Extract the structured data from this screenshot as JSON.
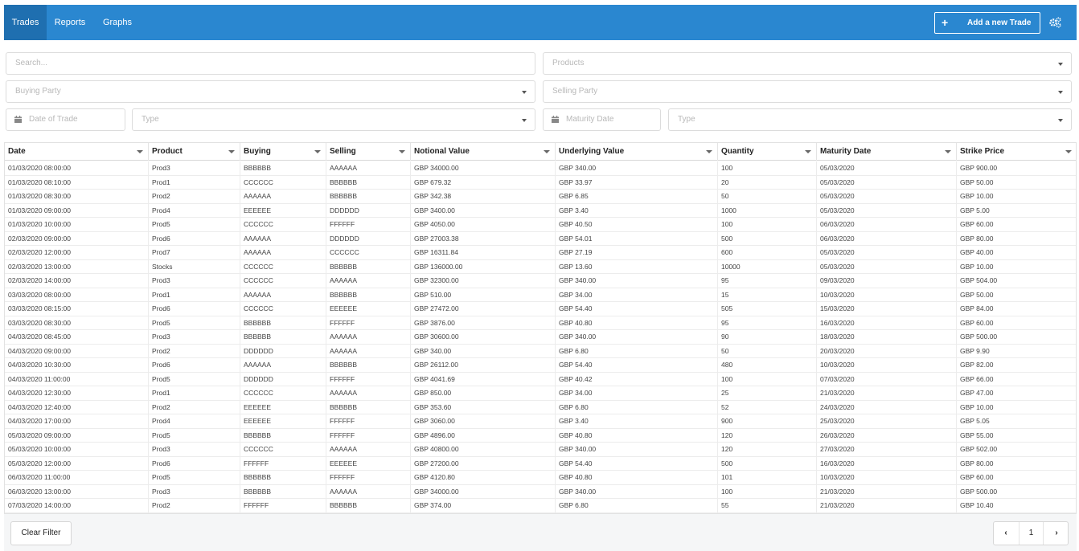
{
  "nav": {
    "tabs": [
      {
        "label": "Trades",
        "active": true
      },
      {
        "label": "Reports",
        "active": false
      },
      {
        "label": "Graphs",
        "active": false
      }
    ],
    "add_button_label": "Add a new Trade",
    "settings_icon": "gears-icon"
  },
  "filters": {
    "search_placeholder": "Search...",
    "products_placeholder": "Products",
    "buying_party_placeholder": "Buying Party",
    "selling_party_placeholder": "Selling Party",
    "date_of_trade_placeholder": "Date of Trade",
    "type_left_placeholder": "Type",
    "maturity_date_placeholder": "Maturity Date",
    "type_right_placeholder": "Type"
  },
  "table": {
    "columns": [
      "Date",
      "Product",
      "Buying",
      "Selling",
      "Notional Value",
      "Underlying Value",
      "Quantity",
      "Maturity Date",
      "Strike Price"
    ],
    "rows": [
      [
        "01/03/2020 08:00:00",
        "Prod3",
        "BBBBBB",
        "AAAAAA",
        "GBP 34000.00",
        "GBP 340.00",
        "100",
        "05/03/2020",
        "GBP 900.00"
      ],
      [
        "01/03/2020 08:10:00",
        "Prod1",
        "CCCCCC",
        "BBBBBB",
        "GBP 679.32",
        "GBP 33.97",
        "20",
        "05/03/2020",
        "GBP 50.00"
      ],
      [
        "01/03/2020 08:30:00",
        "Prod2",
        "AAAAAA",
        "BBBBBB",
        "GBP 342.38",
        "GBP 6.85",
        "50",
        "05/03/2020",
        "GBP 10.00"
      ],
      [
        "01/03/2020 09:00:00",
        "Prod4",
        "EEEEEE",
        "DDDDDD",
        "GBP 3400.00",
        "GBP 3.40",
        "1000",
        "05/03/2020",
        "GBP 5.00"
      ],
      [
        "01/03/2020 10:00:00",
        "Prod5",
        "CCCCCC",
        "FFFFFF",
        "GBP 4050.00",
        "GBP 40.50",
        "100",
        "06/03/2020",
        "GBP 60.00"
      ],
      [
        "02/03/2020 09:00:00",
        "Prod6",
        "AAAAAA",
        "DDDDDD",
        "GBP 27003.38",
        "GBP 54.01",
        "500",
        "06/03/2020",
        "GBP 80.00"
      ],
      [
        "02/03/2020 12:00:00",
        "Prod7",
        "AAAAAA",
        "CCCCCC",
        "GBP 16311.84",
        "GBP 27.19",
        "600",
        "05/03/2020",
        "GBP 40.00"
      ],
      [
        "02/03/2020 13:00:00",
        "Stocks",
        "CCCCCC",
        "BBBBBB",
        "GBP 136000.00",
        "GBP 13.60",
        "10000",
        "05/03/2020",
        "GBP 10.00"
      ],
      [
        "02/03/2020 14:00:00",
        "Prod3",
        "CCCCCC",
        "AAAAAA",
        "GBP 32300.00",
        "GBP 340.00",
        "95",
        "09/03/2020",
        "GBP 504.00"
      ],
      [
        "03/03/2020 08:00:00",
        "Prod1",
        "AAAAAA",
        "BBBBBB",
        "GBP 510.00",
        "GBP 34.00",
        "15",
        "10/03/2020",
        "GBP 50.00"
      ],
      [
        "03/03/2020 08:15:00",
        "Prod6",
        "CCCCCC",
        "EEEEEE",
        "GBP 27472.00",
        "GBP 54.40",
        "505",
        "15/03/2020",
        "GBP 84.00"
      ],
      [
        "03/03/2020 08:30:00",
        "Prod5",
        "BBBBBB",
        "FFFFFF",
        "GBP 3876.00",
        "GBP 40.80",
        "95",
        "16/03/2020",
        "GBP 60.00"
      ],
      [
        "04/03/2020 08:45:00",
        "Prod3",
        "BBBBBB",
        "AAAAAA",
        "GBP 30600.00",
        "GBP 340.00",
        "90",
        "18/03/2020",
        "GBP 500.00"
      ],
      [
        "04/03/2020 09:00:00",
        "Prod2",
        "DDDDDD",
        "AAAAAA",
        "GBP 340.00",
        "GBP 6.80",
        "50",
        "20/03/2020",
        "GBP 9.90"
      ],
      [
        "04/03/2020 10:30:00",
        "Prod6",
        "AAAAAA",
        "BBBBBB",
        "GBP 26112.00",
        "GBP 54.40",
        "480",
        "10/03/2020",
        "GBP 82.00"
      ],
      [
        "04/03/2020 11:00:00",
        "Prod5",
        "DDDDDD",
        "FFFFFF",
        "GBP 4041.69",
        "GBP 40.42",
        "100",
        "07/03/2020",
        "GBP 66.00"
      ],
      [
        "04/03/2020 12:30:00",
        "Prod1",
        "CCCCCC",
        "AAAAAA",
        "GBP 850.00",
        "GBP 34.00",
        "25",
        "21/03/2020",
        "GBP 47.00"
      ],
      [
        "04/03/2020 12:40:00",
        "Prod2",
        "EEEEEE",
        "BBBBBB",
        "GBP 353.60",
        "GBP 6.80",
        "52",
        "24/03/2020",
        "GBP 10.00"
      ],
      [
        "04/03/2020 17:00:00",
        "Prod4",
        "EEEEEE",
        "FFFFFF",
        "GBP 3060.00",
        "GBP 3.40",
        "900",
        "25/03/2020",
        "GBP 5.05"
      ],
      [
        "05/03/2020 09:00:00",
        "Prod5",
        "BBBBBB",
        "FFFFFF",
        "GBP 4896.00",
        "GBP 40.80",
        "120",
        "26/03/2020",
        "GBP 55.00"
      ],
      [
        "05/03/2020 10:00:00",
        "Prod3",
        "CCCCCC",
        "AAAAAA",
        "GBP 40800.00",
        "GBP 340.00",
        "120",
        "27/03/2020",
        "GBP 502.00"
      ],
      [
        "05/03/2020 12:00:00",
        "Prod6",
        "FFFFFF",
        "EEEEEE",
        "GBP 27200.00",
        "GBP 54.40",
        "500",
        "16/03/2020",
        "GBP 80.00"
      ],
      [
        "06/03/2020 11:00:00",
        "Prod5",
        "BBBBBB",
        "FFFFFF",
        "GBP 4120.80",
        "GBP 40.80",
        "101",
        "10/03/2020",
        "GBP 60.00"
      ],
      [
        "06/03/2020 13:00:00",
        "Prod3",
        "BBBBBB",
        "AAAAAA",
        "GBP 34000.00",
        "GBP 340.00",
        "100",
        "21/03/2020",
        "GBP 500.00"
      ],
      [
        "07/03/2020 14:00:00",
        "Prod2",
        "FFFFFF",
        "BBBBBB",
        "GBP 374.00",
        "GBP 6.80",
        "55",
        "21/03/2020",
        "GBP 10.40"
      ]
    ]
  },
  "footer": {
    "clear_filter_label": "Clear Filter",
    "prev_label": "‹",
    "page_number": "1",
    "next_label": "›"
  }
}
